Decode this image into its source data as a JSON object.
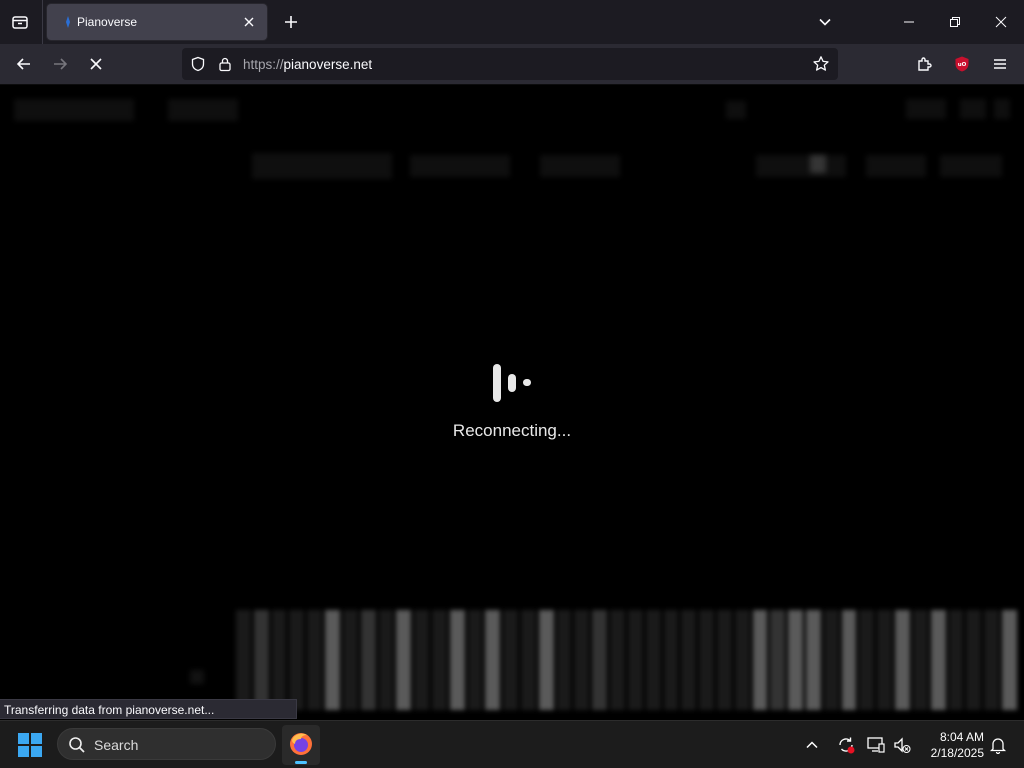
{
  "browser": {
    "tab": {
      "title": "Pianoverse"
    },
    "url": {
      "scheme": "https://",
      "host": "pianoverse.net"
    },
    "status_text": "Transferring data from pianoverse.net..."
  },
  "page": {
    "loading_text": "Reconnecting..."
  },
  "taskbar": {
    "search_label": "Search",
    "time": "8:04 AM",
    "date": "2/18/2025"
  },
  "colors": {
    "accent": "#4cc2ff",
    "windows_logo": "#3ba8f2",
    "ublock": "#c8102e"
  }
}
